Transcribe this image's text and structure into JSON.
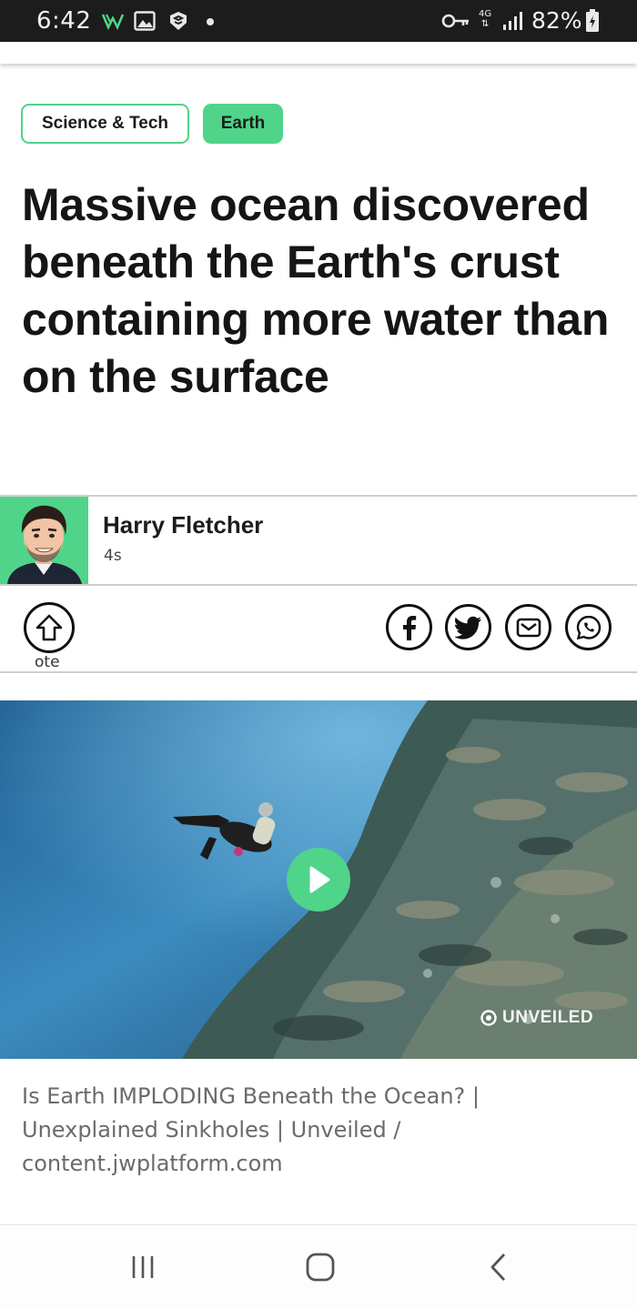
{
  "status_bar": {
    "time": "6:42",
    "network": "4G",
    "battery": "82%",
    "icons": [
      "notification-icon",
      "image-icon",
      "app-icon",
      "dot-icon",
      "key-icon",
      "network-arrows-icon",
      "signal-icon",
      "battery-charging-icon"
    ]
  },
  "tags": [
    {
      "label": "Science & Tech"
    },
    {
      "label": "Earth"
    }
  ],
  "article": {
    "title": "Massive ocean discovered beneath the Earth's crust containing more water than on the surface"
  },
  "author": {
    "name": "Harry Fletcher",
    "time": "4s"
  },
  "actions": {
    "vote_label": "ote",
    "share_icons": [
      "facebook-icon",
      "twitter-icon",
      "email-icon",
      "whatsapp-icon"
    ]
  },
  "video": {
    "watermark": "UNVEILED",
    "caption": "Is Earth IMPLODING Beneath the Ocean? | Unexplained Sinkholes | Unveiled / content.jwplatform.com"
  },
  "nav": {
    "buttons": [
      "recent-apps-icon",
      "home-icon",
      "back-icon"
    ]
  },
  "colors": {
    "accent": "#4fd489",
    "status_bar": "#1c1c1c"
  }
}
